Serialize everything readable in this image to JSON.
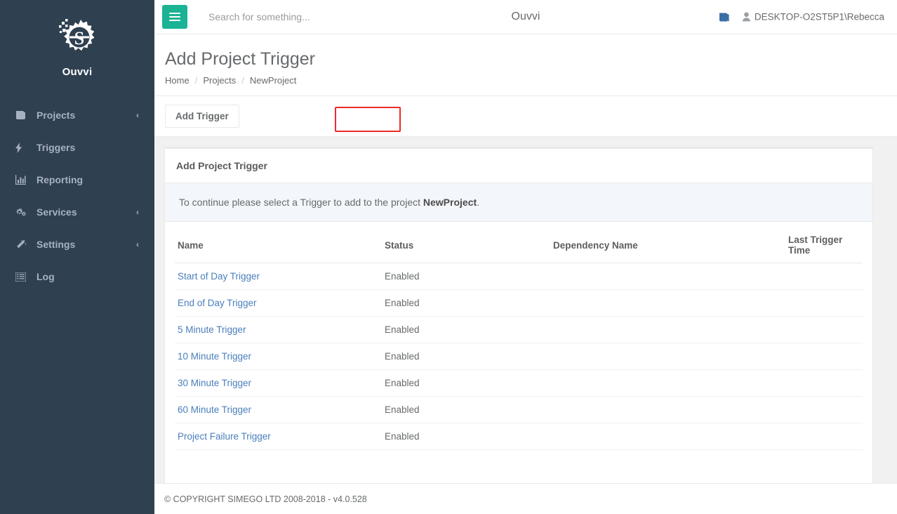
{
  "sidebar": {
    "brand_name": "Ouvvi",
    "logo_icon": "gear-s-logo",
    "items": [
      {
        "label": "Projects",
        "icon": "book-icon",
        "has_chevron": true,
        "chevron": "‹"
      },
      {
        "label": "Triggers",
        "icon": "bolt-icon",
        "has_chevron": false,
        "chevron": ""
      },
      {
        "label": "Reporting",
        "icon": "bar-chart-icon",
        "has_chevron": false,
        "chevron": ""
      },
      {
        "label": "Services",
        "icon": "gears-icon",
        "has_chevron": true,
        "chevron": "‹"
      },
      {
        "label": "Settings",
        "icon": "magic-wand-icon",
        "has_chevron": true,
        "chevron": "‹"
      },
      {
        "label": "Log",
        "icon": "list-icon",
        "has_chevron": false,
        "chevron": ""
      }
    ]
  },
  "topbar": {
    "menu_toggle_icon": "hamburger-icon",
    "menu_toggle_color": "#1ab394",
    "search_placeholder": "Search for something...",
    "search_value": "",
    "app_title": "Ouvvi",
    "book_icon": "book-icon",
    "user_icon": "person-icon",
    "user_name": "DESKTOP-O2ST5P1\\Rebecca"
  },
  "page": {
    "title": "Add Project Trigger",
    "breadcrumb": [
      {
        "label": "Home",
        "current": false
      },
      {
        "label": "Projects",
        "current": false
      },
      {
        "label": "NewProject",
        "current": true
      }
    ],
    "breadcrumb_separator": "/",
    "tab_label": "Add Trigger",
    "highlight_color": "#ec2a2a"
  },
  "card": {
    "title": "Add Project Trigger",
    "note_prefix": "To continue please select a Trigger to add to the project ",
    "note_project": "NewProject",
    "note_suffix": ".",
    "columns": [
      "Name",
      "Status",
      "Dependency Name",
      "Last Trigger Time"
    ],
    "rows": [
      {
        "name": "Start of Day Trigger",
        "status": "Enabled",
        "dependency": "",
        "last_trigger_time": ""
      },
      {
        "name": "End of Day Trigger",
        "status": "Enabled",
        "dependency": "",
        "last_trigger_time": ""
      },
      {
        "name": "5 Minute Trigger",
        "status": "Enabled",
        "dependency": "",
        "last_trigger_time": ""
      },
      {
        "name": "10 Minute Trigger",
        "status": "Enabled",
        "dependency": "",
        "last_trigger_time": ""
      },
      {
        "name": "30 Minute Trigger",
        "status": "Enabled",
        "dependency": "",
        "last_trigger_time": ""
      },
      {
        "name": "60 Minute Trigger",
        "status": "Enabled",
        "dependency": "",
        "last_trigger_time": ""
      },
      {
        "name": "Project Failure Trigger",
        "status": "Enabled",
        "dependency": "",
        "last_trigger_time": ""
      }
    ]
  },
  "footer": {
    "copyright": "© COPYRIGHT SIMEGO LTD 2008-2018 - v4.0.528"
  },
  "colors": {
    "sidebar_bg": "#2f4050",
    "accent_green": "#1ab394",
    "link_blue": "#4a7ebb",
    "text_gray": "#676a6c",
    "page_bg": "#f1f1f1",
    "note_bg": "#f3f6fa"
  }
}
